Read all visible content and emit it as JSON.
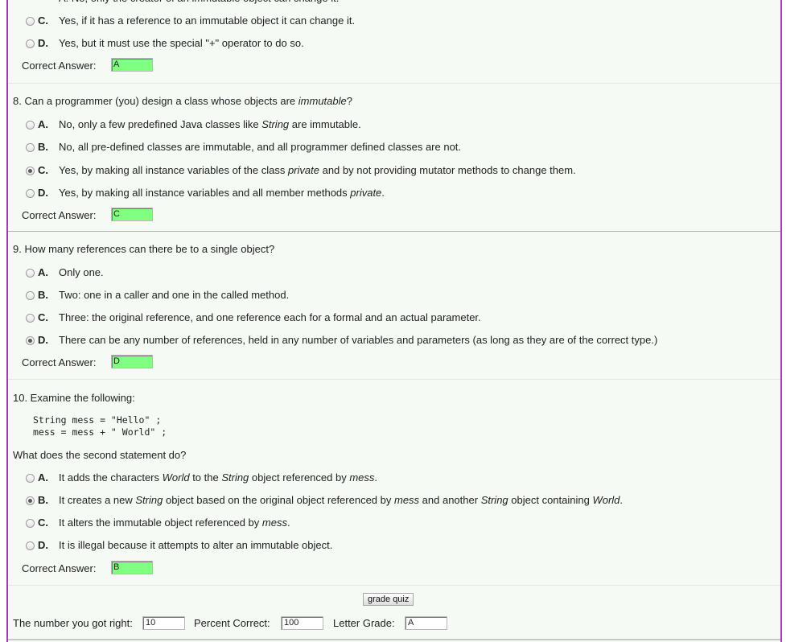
{
  "q7": {
    "partial_line": "A. No, only the creator of an immutable object can change it.",
    "options": [
      {
        "letter": "C.",
        "text": "Yes, if it has a reference to an immutable object it can change it.",
        "checked": false
      },
      {
        "letter": "D.",
        "text": "Yes, but it must use the special \"+\" operator to do so.",
        "checked": false
      }
    ],
    "answer_label": "Correct Answer:",
    "answer": "A"
  },
  "q8": {
    "question_prefix": "8. Can a programmer (you) design a class whose objects are ",
    "question_em": "immutable",
    "question_suffix": "?",
    "options": [
      {
        "letter": "A.",
        "pre": "No, only a few predefined Java classes like ",
        "em": "String",
        "post": " are immutable.",
        "checked": false
      },
      {
        "letter": "B.",
        "pre": "No, all pre-defined classes are immutable, and all programmer defined classes are not.",
        "em": "",
        "post": "",
        "checked": false
      },
      {
        "letter": "C.",
        "pre": "Yes, by making all instance variables of the class ",
        "em": "private",
        "post": " and by not providing mutator methods to change them.",
        "checked": true
      },
      {
        "letter": "D.",
        "pre": "Yes, by making all instance variables and all member methods ",
        "em": "private",
        "post": ".",
        "checked": false
      }
    ],
    "answer_label": "Correct Answer:",
    "answer": "C"
  },
  "q9": {
    "question": "9. How many references can there be to a single object?",
    "options": [
      {
        "letter": "A.",
        "text": "Only one.",
        "checked": false
      },
      {
        "letter": "B.",
        "text": "Two: one in a caller and one in the called method.",
        "checked": false
      },
      {
        "letter": "C.",
        "text": "Three: the original reference, and one reference each for a formal and an actual parameter.",
        "checked": false
      },
      {
        "letter": "D.",
        "text": "There can be any number of references, held in any number of variables and parameters (as long as they are of the correct type.)",
        "checked": true
      }
    ],
    "answer_label": "Correct Answer:",
    "answer": "D"
  },
  "q10": {
    "question": "10. Examine the following:",
    "code_line1": "String mess = \"Hello\" ;",
    "code_line2": "mess = mess + \" World\" ;",
    "prompt": "What does the second statement do?",
    "options": [
      {
        "letter": "A.",
        "parts": [
          [
            "It adds the characters ",
            ""
          ],
          [
            "World",
            "i"
          ],
          [
            " to the ",
            ""
          ],
          [
            "String",
            "i"
          ],
          [
            " object referenced by ",
            ""
          ],
          [
            "mess",
            "i"
          ],
          [
            ".",
            ""
          ]
        ],
        "checked": false
      },
      {
        "letter": "B.",
        "parts": [
          [
            "It creates a new ",
            ""
          ],
          [
            "String",
            "i"
          ],
          [
            " object based on the original object referenced by ",
            ""
          ],
          [
            "mess",
            "i"
          ],
          [
            " and another ",
            ""
          ],
          [
            "String",
            "i"
          ],
          [
            " object containing ",
            ""
          ],
          [
            "World",
            "i"
          ],
          [
            ".",
            ""
          ]
        ],
        "checked": true
      },
      {
        "letter": "C.",
        "parts": [
          [
            "It alters the immutable object referenced by ",
            ""
          ],
          [
            "mess",
            "i"
          ],
          [
            ".",
            ""
          ]
        ],
        "checked": false
      },
      {
        "letter": "D.",
        "parts": [
          [
            "It is illegal because it attempts to alter an immutable object.",
            ""
          ]
        ],
        "checked": false
      }
    ],
    "answer_label": "Correct Answer:",
    "answer": "B"
  },
  "grading": {
    "button_label": "grade quiz",
    "right_label": "The number you got right:",
    "right_value": "10",
    "percent_label": "Percent Correct:",
    "percent_value": "100",
    "grade_label": "Letter Grade:",
    "grade_value": "A"
  },
  "colors": {
    "correct_answer_bg": "#80ff80",
    "frame_border": "#9b3fb5",
    "panel_bg": "#f5faf5"
  }
}
